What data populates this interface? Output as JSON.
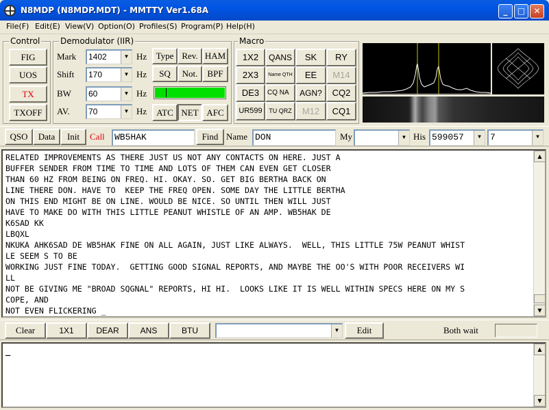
{
  "window": {
    "title": "N8MDP (N8MDP.MDT) - MMTTY Ver1.68A"
  },
  "menu": [
    "File(F)",
    "Edit(E)",
    "View(V)",
    "Option(O)",
    "Profiles(S)",
    "Program(P)",
    "Help(H)"
  ],
  "control": {
    "label": "Control",
    "buttons": [
      "FIG",
      "UOS",
      "TX",
      "TXOFF"
    ],
    "tx_color": "#E00000"
  },
  "demod": {
    "label": "Demodulator (IIR)",
    "mark_label": "Mark",
    "mark_value": "1402",
    "shift_label": "Shift",
    "shift_value": "170",
    "bw_label": "BW",
    "bw_value": "60",
    "av_label": "AV.",
    "av_value": "70",
    "hz": "Hz",
    "type_btn": "Type",
    "rev_btn": "Rev.",
    "ham_btn": "HAM",
    "sq_btn": "SQ",
    "not_btn": "Not.",
    "bpf_btn": "BPF",
    "atc_btn": "ATC",
    "net_btn": "NET",
    "afc_btn": "AFC",
    "level_color": "#00E000"
  },
  "macro": {
    "label": "Macro",
    "row1": [
      "1X2",
      "QANS",
      "SK",
      "RY"
    ],
    "row2": [
      "2X3",
      "Name QTH",
      "EE",
      "M14"
    ],
    "row3": [
      "DE3",
      "CQ NA",
      "AGN?",
      "CQ2"
    ],
    "row4": [
      "UR599",
      "TU QRZ",
      "M12",
      "CQ1"
    ]
  },
  "qso": {
    "qso_btn": "QSO",
    "data_btn": "Data",
    "init_btn": "Init",
    "call_label": "Call",
    "call_value": "WB5HAK",
    "find_btn": "Find",
    "name_label": "Name",
    "name_value": "DON",
    "my_label": "My",
    "my_value": "",
    "his_label": "His",
    "his_value": "599057",
    "extra_value": "7",
    "call_color": "#E00000"
  },
  "rx_lines": [
    "RELATED IMPROVEMENTS AS THERE JUST US NOT ANY CONTACTS ON HERE. JUST A",
    "BUFFER SENDER FROM TIME TO TIME AND LOTS OF THEM CAN EVEN GET CLOSER",
    "THAN 60 HZ FROM BEING ON FREQ. HI. OKAY. SO. GET BIG BERTHA BACK ON",
    "LINE THERE DON. HAVE TO  KEEP THE FREQ OPEN. SOME DAY THE LITTLE BERTHA",
    "ON THIS END MIGHT BE ON LINE. WOULD BE NICE. SO UNTIL THEN WILL JUST",
    "HAVE TO MAKE DO WITH THIS LITTLE PEANUT WHISTLE OF AN AMP. WB5HAK DE",
    "K6SAD KK",
    "LBQXL",
    "NKUKA AHK6SAD DE WB5HAK FINE ON ALL AGAIN, JUST LIKE ALWAYS.  WELL, THIS LITTLE 75W PEANUT WHIST",
    "LE SEEM S TO BE",
    "WORKING JUST FINE TODAY.  GETTING GOOD SIGNAL REPORTS, AND MAYBE THE OO'S WITH POOR RECEIVERS WI",
    "LL",
    "NOT BE GIVING ME \"BROAD SQGNAL\" REPORTS, HI HI.  LOOKS LIKE IT IS WELL WITHIN SPECS HERE ON MY S",
    "COPE, AND",
    "NOT EVEN FLICKERING _"
  ],
  "toolbar": {
    "clear": "Clear",
    "b1x1": "1X1",
    "dear": "DEAR",
    "ans": "ANS",
    "btu": "BTU",
    "edit": "Edit",
    "both_wait": "Both wait",
    "combo_value": ""
  },
  "tx_text": "_"
}
